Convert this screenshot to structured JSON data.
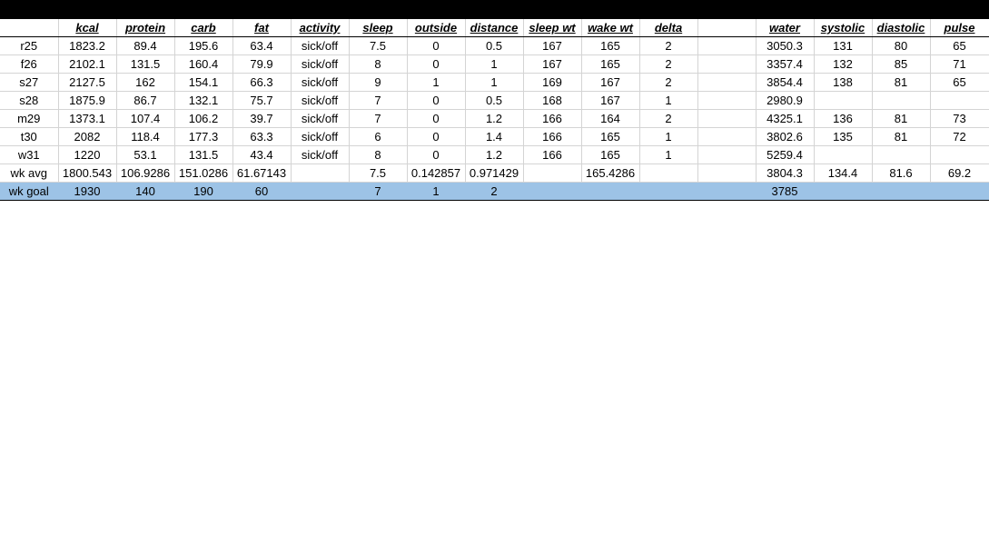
{
  "columns": [
    "",
    "kcal",
    "protein",
    "carb",
    "fat",
    "activity",
    "sleep",
    "outside",
    "distance",
    "sleep wt",
    "wake wt",
    "delta",
    "",
    "water",
    "systolic",
    "diastolic",
    "pulse"
  ],
  "rows": [
    [
      "r25",
      "1823.2",
      "89.4",
      "195.6",
      "63.4",
      "sick/off",
      "7.5",
      "0",
      "0.5",
      "167",
      "165",
      "2",
      "",
      "3050.3",
      "131",
      "80",
      "65"
    ],
    [
      "f26",
      "2102.1",
      "131.5",
      "160.4",
      "79.9",
      "sick/off",
      "8",
      "0",
      "1",
      "167",
      "165",
      "2",
      "",
      "3357.4",
      "132",
      "85",
      "71"
    ],
    [
      "s27",
      "2127.5",
      "162",
      "154.1",
      "66.3",
      "sick/off",
      "9",
      "1",
      "1",
      "169",
      "167",
      "2",
      "",
      "3854.4",
      "138",
      "81",
      "65"
    ],
    [
      "s28",
      "1875.9",
      "86.7",
      "132.1",
      "75.7",
      "sick/off",
      "7",
      "0",
      "0.5",
      "168",
      "167",
      "1",
      "",
      "2980.9",
      "",
      "",
      ""
    ],
    [
      "m29",
      "1373.1",
      "107.4",
      "106.2",
      "39.7",
      "sick/off",
      "7",
      "0",
      "1.2",
      "166",
      "164",
      "2",
      "",
      "4325.1",
      "136",
      "81",
      "73"
    ],
    [
      "t30",
      "2082",
      "118.4",
      "177.3",
      "63.3",
      "sick/off",
      "6",
      "0",
      "1.4",
      "166",
      "165",
      "1",
      "",
      "3802.6",
      "135",
      "81",
      "72"
    ],
    [
      "w31",
      "1220",
      "53.1",
      "131.5",
      "43.4",
      "sick/off",
      "8",
      "0",
      "1.2",
      "166",
      "165",
      "1",
      "",
      "5259.4",
      "",
      "",
      ""
    ],
    [
      "wk avg",
      "1800.543",
      "106.9286",
      "151.0286",
      "61.67143",
      "",
      "7.5",
      "0.142857",
      "0.971429",
      "",
      "165.4286",
      "",
      "",
      "3804.3",
      "134.4",
      "81.6",
      "69.2"
    ]
  ],
  "goal_row": [
    "wk goal",
    "1930",
    "140",
    "190",
    "60",
    "",
    "7",
    "1",
    "2",
    "",
    "",
    "",
    "",
    "3785",
    "",
    "",
    ""
  ],
  "colors": {
    "header_bar": "#000000",
    "goal_row_bg": "#9dc3e6",
    "gridline": "#d4d4d4"
  }
}
